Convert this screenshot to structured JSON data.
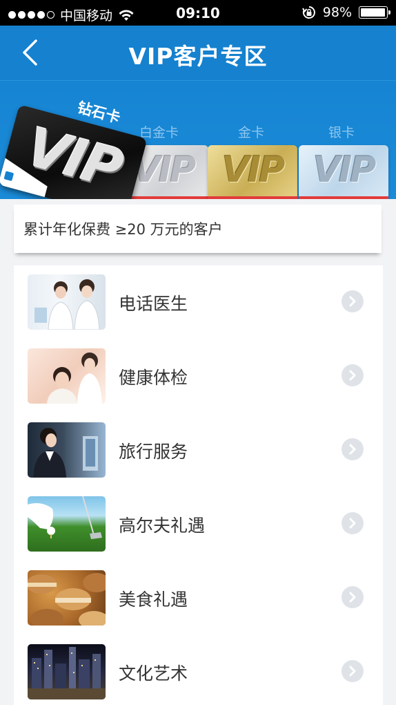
{
  "status_bar": {
    "carrier": "中国移动",
    "time": "09:10",
    "battery": "98%",
    "battery_level": 0.98
  },
  "nav": {
    "title": "VIP客户专区"
  },
  "banner": {
    "cards": [
      {
        "tier": "钻石卡",
        "text": "VIP"
      },
      {
        "tier": "白金卡",
        "text": "VIP"
      },
      {
        "tier": "金卡",
        "text": "VIP"
      },
      {
        "tier": "银卡",
        "text": "VIP"
      }
    ]
  },
  "criterion": "累计年化保费 ≥20 万元的客户",
  "services": [
    {
      "label": "电话医生",
      "icon": "doctor-photo"
    },
    {
      "label": "健康体检",
      "icon": "health-check-photo"
    },
    {
      "label": "旅行服务",
      "icon": "travel-service-photo"
    },
    {
      "label": "高尔夫礼遇",
      "icon": "golf-photo"
    },
    {
      "label": "美食礼遇",
      "icon": "macaron-photo"
    },
    {
      "label": "文化艺术",
      "icon": "city-night-photo"
    }
  ],
  "colors": {
    "primary": "#1581cf",
    "background": "#f2f3f5"
  }
}
